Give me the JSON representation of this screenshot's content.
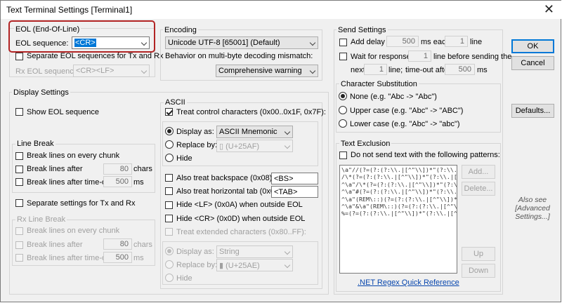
{
  "window": {
    "title": "Text Terminal Settings [Terminal1]",
    "close": "✕"
  },
  "eol": {
    "group": "EOL (End-Of-Line)",
    "sequence_label": "EOL sequence:",
    "sequence_value": "<CR>",
    "separate_label": "Separate EOL sequences for Tx and Rx",
    "rx_label": "Rx EOL sequence:",
    "rx_value": "<CR><LF>"
  },
  "encoding": {
    "group": "Encoding",
    "value": "Unicode UTF-8 [65001] (Default)",
    "mismatch_label": "Behavior on multi-byte decoding mismatch:",
    "mismatch_value": "Comprehensive warning"
  },
  "display": {
    "group": "Display Settings",
    "show_eol": "Show EOL sequence",
    "line_break": {
      "group": "Line Break",
      "every_chunk": "Break lines on every chunk",
      "after": "Break lines after",
      "after_value": "80",
      "after_unit": "chars",
      "timeout": "Break lines after time-out of",
      "timeout_value": "500",
      "timeout_unit": "ms"
    },
    "separate": "Separate settings for Tx and Rx",
    "rx_line_break": {
      "group": "Rx Line Break",
      "every_chunk": "Break lines on every chunk",
      "after": "Break lines after",
      "after_value": "80",
      "after_unit": "chars",
      "timeout": "Break lines after time-out of",
      "timeout_value": "500",
      "timeout_unit": "ms"
    }
  },
  "ascii": {
    "group": "ASCII",
    "treat_control": "Treat control characters (0x00..0x1F, 0x7F):",
    "display_as": "Display as:",
    "display_as_value": "ASCII Mnemonic",
    "replace_by": "Replace by:",
    "replace_by_value": "▯ (U+25AF)",
    "hide": "Hide",
    "backspace": "Also treat backspace (0x08), as",
    "backspace_value": "<BS>",
    "tab": "Also treat horizontal tab (0x09), as",
    "tab_value": "<TAB>",
    "hide_lf": "Hide <LF> (0x0A) when outside EOL",
    "hide_cr": "Hide <CR> (0x0D) when outside EOL",
    "extended": "Treat extended characters (0x80..FF):",
    "ext_display_as": "Display as:",
    "ext_display_as_value": "String",
    "ext_replace_by": "Replace by:",
    "ext_replace_by_value": "▮ (U+25AE)",
    "ext_hide": "Hide"
  },
  "send": {
    "group": "Send Settings",
    "add_delay": "Add delay of",
    "delay_value": "500",
    "ms_each": "ms each",
    "line_value": "1",
    "line": "line",
    "wait": "Wait for response of",
    "wait_value": "1",
    "wait_suffix": "line before sending the",
    "next": "next",
    "next_value": "1",
    "line_semi": "line;",
    "timeout_after": "time-out after",
    "timeout_value": "500",
    "ms": "ms"
  },
  "substitution": {
    "group": "Character Substitution",
    "none": "None (e.g. \"Abc -> \"Abc\")",
    "upper": "Upper case (e.g. \"Abc\" -> \"ABC\")",
    "lower": "Lower case (e.g. \"Abc\" -> \"abc\")"
  },
  "exclusion": {
    "group": "Text Exclusion",
    "dont_send": "Do not send text with the following patterns:",
    "patterns": [
      "\\a\"//(?=(?:(?:\\\\.|[^\"\\\\])*\"(?:\\\\.|[^\"\\\\])*\")*(?",
      "/\\*(?=(?:(?:\\\\.|[^\"\\\\])*\"(?:\\\\.|[^\"\\\\])*\")",
      "^\\a\"/\\*(?=(?:(?:\\\\.|[^\"\\\\])*\"(?:\\\\.|[^\"\\\\])*",
      "^\\a\"#(?=(?:(?:\\\\.|[^\"\\\\])*\"(?:\\\\.|[^\"\\\\])*\")",
      "^\\a\"(REM\\::)(?=(?:(?:\\\\.|[^\"\\\\])*\"(?:\\\\.",
      "^\\a\"&\\a\"(REM\\::)(?=(?:(?:\\\\.|[^\"\\\\])*\"(?:\\\\.|",
      "%=(?=(?:(?:\\\\.|[^\"\\\\])*\"(?:\\\\.|[^\"\\\\])*\")*(?"
    ],
    "add": "Add...",
    "delete": "Delete...",
    "up": "Up",
    "down": "Down",
    "link": ".NET Regex Quick Reference"
  },
  "buttons": {
    "ok": "OK",
    "cancel": "Cancel",
    "defaults": "Defaults..."
  },
  "note": {
    "line1": "Also see",
    "line2": "[Advanced",
    "line3": "Settings...]"
  }
}
